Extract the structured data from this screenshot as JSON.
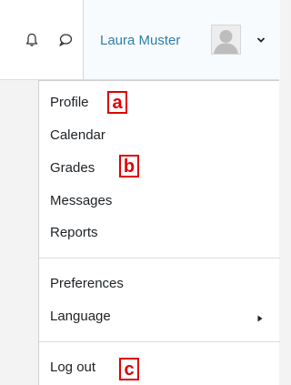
{
  "header": {
    "user_name": "Laura Muster",
    "icons": [
      "bell-icon",
      "chat-bubble-icon",
      "avatar-placeholder",
      "chevron-down-icon"
    ],
    "link_color": "#2d7ea7"
  },
  "user_menu": {
    "items": [
      {
        "label": "Profile"
      },
      {
        "label": "Calendar"
      },
      {
        "label": "Grades"
      },
      {
        "label": "Messages"
      },
      {
        "label": "Reports"
      },
      {
        "label": "Preferences"
      },
      {
        "label": "Language",
        "has_submenu": true
      },
      {
        "label": "Log out"
      }
    ]
  },
  "markers": {
    "a": "a",
    "b": "b",
    "c": "c",
    "color": "#e00000"
  }
}
